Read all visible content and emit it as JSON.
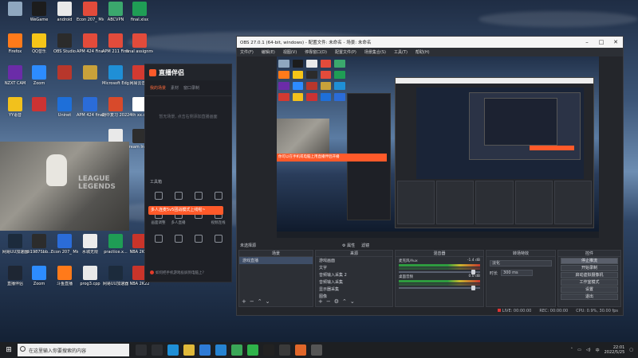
{
  "desktop": {
    "icons": [
      {
        "label": "",
        "icon": "recycle-bin-icon",
        "color": "#8fa7bf"
      },
      {
        "label": "WeGame",
        "icon": "wegame-icon",
        "color": "#1c1c1c"
      },
      {
        "label": "android",
        "icon": "file-icon",
        "color": "#e9e9e9"
      },
      {
        "label": "Econ 207_ Midterm II...",
        "icon": "pdf-icon",
        "color": "#e24b3b"
      },
      {
        "label": "ABCVPN",
        "icon": "vpn-icon",
        "color": "#3ba86d"
      },
      {
        "label": "final.xlsx",
        "icon": "excel-icon",
        "color": "#1f9d55"
      },
      {
        "label": "Firefox",
        "icon": "firefox-icon",
        "color": "#ff7a1a"
      },
      {
        "label": "QQ音乐",
        "icon": "qq-music-icon",
        "color": "#f5c518"
      },
      {
        "label": "OBS Studio",
        "icon": "obs-icon",
        "color": "#2b2b2b"
      },
      {
        "label": "APM 424 Final .pdf",
        "icon": "pdf-icon",
        "color": "#e24b3b"
      },
      {
        "label": "APM 211 Final Scor...",
        "icon": "pdf-icon",
        "color": "#e24b3b"
      },
      {
        "label": "final assignment73...",
        "icon": "pdf-icon",
        "color": "#e24b3b"
      },
      {
        "label": "NZXT CAM",
        "icon": "nzxt-icon",
        "color": "#6b2ca8"
      },
      {
        "label": "Zoom",
        "icon": "zoom-icon",
        "color": "#2d8cff"
      },
      {
        "label": "",
        "icon": "game-icon",
        "color": "#b8372c"
      },
      {
        "label": "",
        "icon": "game-icon",
        "color": "#c8a13a"
      },
      {
        "label": "Microsoft Edge",
        "icon": "edge-icon",
        "color": "#1f8fd6"
      },
      {
        "label": "网易云音乐",
        "icon": "netease-icon",
        "color": "#d33a31"
      },
      {
        "label": "YY语音",
        "icon": "yy-icon",
        "color": "#f2c11c"
      },
      {
        "label": "",
        "icon": "app-icon",
        "color": "#cc3333"
      },
      {
        "label": "Uninet",
        "icon": "uninet-icon",
        "color": "#1e6fd9"
      },
      {
        "label": "APM 424 final.docx",
        "icon": "word-icon",
        "color": "#2b6cd8"
      },
      {
        "label": "期中复习 2022年答...",
        "icon": "ppt-icon",
        "color": "#d84a2b"
      },
      {
        "label": "4th xx.csv",
        "icon": "csv-icon",
        "color": "#ffffff"
      },
      {
        "label": "CS 250 #2",
        "icon": "file-icon",
        "color": "#e9e9e9"
      },
      {
        "label": "Dream Integr...",
        "icon": "app-icon",
        "color": "#2d2d2d"
      },
      {
        "label": "网易UU加速器",
        "icon": "uu-icon",
        "color": "#1c2b3c"
      },
      {
        "label": "di1987Sbb...",
        "icon": "file-icon",
        "color": "#2c2c2c"
      },
      {
        "label": "Econ 207_ Midterm ...",
        "icon": "word-icon",
        "color": "#2b6cd8"
      },
      {
        "label": "水城无限",
        "icon": "app-icon",
        "color": "#ececec"
      },
      {
        "label": "practice.x...",
        "icon": "excel-icon",
        "color": "#1f9d55"
      },
      {
        "label": "NBA 2K21",
        "icon": "nba-icon",
        "color": "#c9342a"
      },
      {
        "label": "直播伴侣",
        "icon": "live-icon",
        "color": "#1e2633"
      },
      {
        "label": "Zoom",
        "icon": "zoom-icon",
        "color": "#2d8cff"
      },
      {
        "label": "斗鱼直播",
        "icon": "douyu-icon",
        "color": "#ff7a1a"
      },
      {
        "label": "prog3.cpp",
        "icon": "file-icon",
        "color": "#e9e9e9"
      },
      {
        "label": "网易UU加速器",
        "icon": "uu-icon",
        "color": "#1c2b3c"
      },
      {
        "label": "NBA 2K22",
        "icon": "nba-icon",
        "color": "#c9342a"
      }
    ]
  },
  "stream_app": {
    "logo": "直播伴侣",
    "tabs": [
      "我的场景",
      "素材",
      "窗口录制"
    ],
    "hint": "暂无场景, 点击右侧添加直播画面",
    "toolbox_title": "工具箱",
    "tools": [
      {
        "label": "",
        "icon": "camera-icon"
      },
      {
        "label": "",
        "icon": "user-icon"
      },
      {
        "label": "",
        "icon": "gift-icon"
      },
      {
        "label": "",
        "icon": "sticker-icon"
      },
      {
        "label": "画面调整",
        "icon": "adjust-icon"
      },
      {
        "label": "多人直播",
        "icon": "multi-icon"
      },
      {
        "label": "",
        "icon": "chat-icon"
      },
      {
        "label": "视频连线",
        "icon": "video-icon"
      },
      {
        "label": "",
        "icon": "game-icon"
      },
      {
        "label": "",
        "icon": "lock-icon"
      },
      {
        "label": "",
        "icon": "music-icon"
      },
      {
        "label": "",
        "icon": "more-icon"
      }
    ],
    "live_banner": "多人连麦5v5团战模式上线啦~",
    "footer_note": "如何把手机游戏投屏到电脑上?"
  },
  "obs": {
    "title": "OBS 27.0.1 (64-bit, windows) - 配置文件: 未命名 - 场景: 未命名",
    "menu": [
      "文件(F)",
      "编辑(E)",
      "视图(V)",
      "停靠窗口(D)",
      "配置文件(P)",
      "场景集合(S)",
      "工具(T)",
      "帮助(H)"
    ],
    "preview_banner": "你可以在手机或电脑上用直播伴侣开播",
    "below_preview": {
      "left": "未选择源",
      "props": "⚙ 属性",
      "filters": "滤镜"
    },
    "scenes": {
      "header": "场景",
      "items": [
        "游戏直播"
      ]
    },
    "sources": {
      "header": "来源",
      "items": [
        "游戏画面",
        "文字",
        "音频输入采集 2",
        "音频输入采集",
        "显示器采集",
        "图像"
      ]
    },
    "mixer": {
      "header": "混音器",
      "tracks": [
        {
          "name": "麦克风/Aux",
          "db": "-1.4 dB"
        },
        {
          "name": "桌面音频",
          "db": "0.0 dB"
        }
      ]
    },
    "transitions": {
      "header": "转场特效",
      "selected": "淡化",
      "duration_label": "时长",
      "duration": "300 ms"
    },
    "controls": {
      "header": "控件",
      "buttons": [
        "停止推流",
        "开始录制",
        "启动虚拟摄像机",
        "工作室模式",
        "设置",
        "退出"
      ]
    },
    "status": {
      "live": "LIVE: 00:00:00",
      "rec": "REC: 00:00:00",
      "cpu": "CPU: 0.9%, 30.00 fps"
    }
  },
  "taskbar": {
    "search_placeholder": "在这里输入你要搜索的内容",
    "apps": [
      {
        "icon": "task-view-icon",
        "color": "#2d2f33"
      },
      {
        "icon": "cortana-icon",
        "color": "#2d2f33"
      },
      {
        "icon": "edge-icon",
        "color": "#1f8fd6"
      },
      {
        "icon": "explorer-icon",
        "color": "#e0b93a"
      },
      {
        "icon": "store-icon",
        "color": "#2e7bd6"
      },
      {
        "icon": "vscode-icon",
        "color": "#2683d1"
      },
      {
        "icon": "chrome-icon",
        "color": "#3aa757"
      },
      {
        "icon": "wechat-icon",
        "color": "#2fb34a"
      },
      {
        "icon": "qq-icon",
        "color": "#222"
      },
      {
        "icon": "obs-icon",
        "color": "#3a3a3a"
      },
      {
        "icon": "live-icon",
        "color": "#e1672a"
      },
      {
        "icon": "app-icon",
        "color": "#555"
      }
    ],
    "time": "22:01",
    "date": "2022/5/25"
  }
}
